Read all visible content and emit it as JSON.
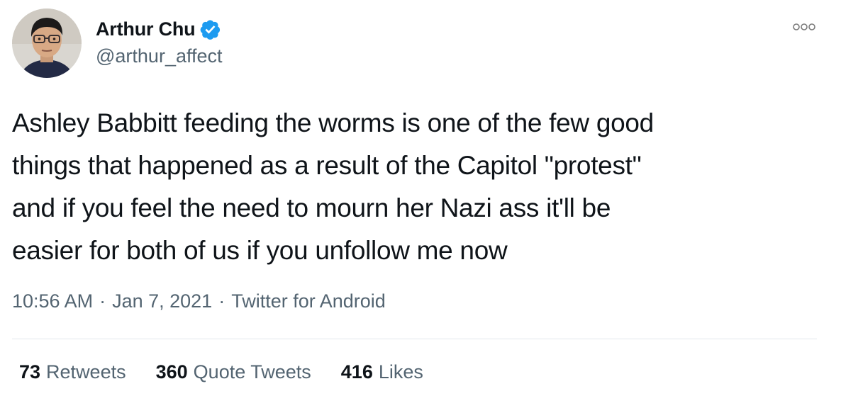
{
  "author": {
    "display_name": "Arthur Chu",
    "handle": "@arthur_affect",
    "verified": true,
    "avatar_icon": "profile-photo",
    "verified_icon": "verified-badge-icon"
  },
  "more_icon": "more-options-icon",
  "tweet": {
    "text": "Ashley Babbitt feeding the worms is one of the few good\nthings that happened as a result of the Capitol \"protest\"\nand if you feel the need to mourn her Nazi ass it'll be\neasier for both of us if you unfollow me now",
    "time": "10:56 AM",
    "date": "Jan 7, 2021",
    "source": "Twitter for Android",
    "separator": "·"
  },
  "stats": {
    "retweets": {
      "count": "73",
      "label": "Retweets"
    },
    "quote_tweets": {
      "count": "360",
      "label": "Quote Tweets"
    },
    "likes": {
      "count": "416",
      "label": "Likes"
    }
  },
  "colors": {
    "text_primary": "#0f1419",
    "text_secondary": "#536471",
    "verified_blue": "#1d9bf0",
    "divider": "#e1e8ed"
  }
}
